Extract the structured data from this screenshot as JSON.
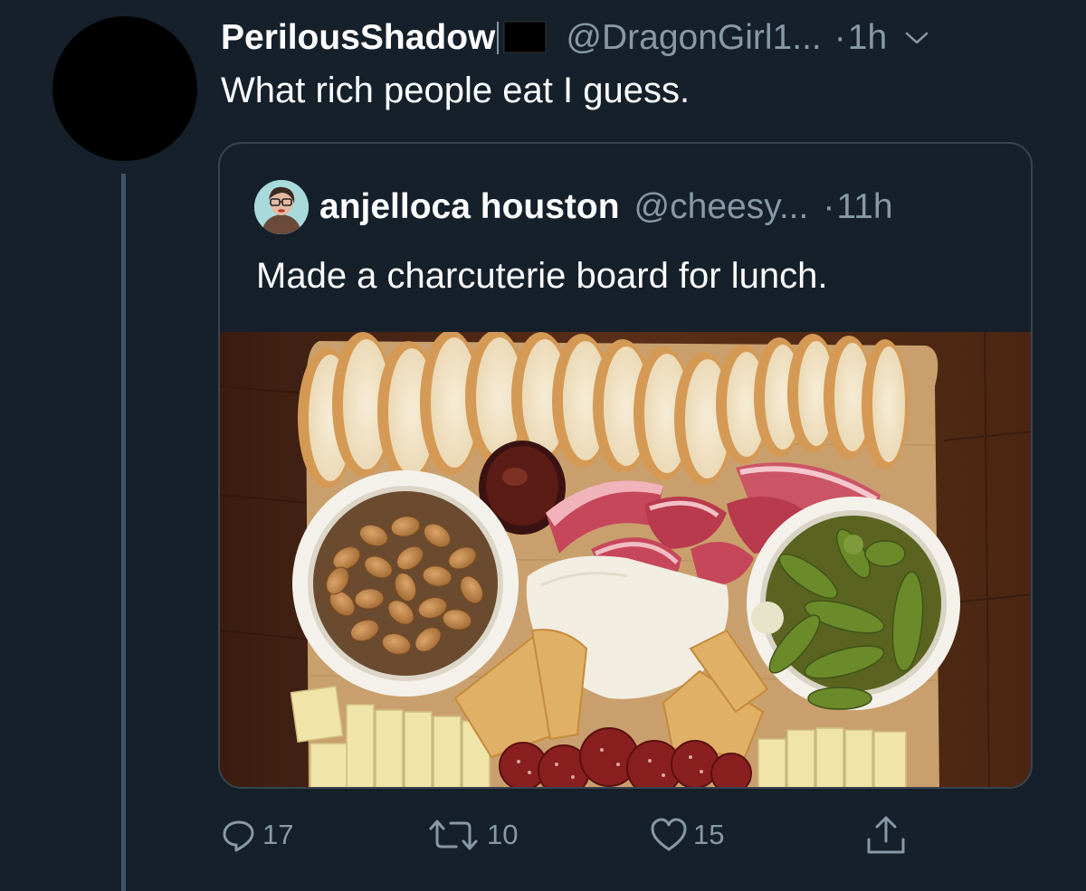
{
  "tweet": {
    "display_name": "PerilousShadow",
    "handle": "@DragonGirl1...",
    "dot": "·",
    "time": "1h",
    "text": "What rich people eat I guess."
  },
  "quoted_tweet": {
    "display_name": "anjelloca houston",
    "handle": "@cheesy...",
    "dot": "·",
    "time": "11h",
    "text": "Made a charcuterie board for lunch."
  },
  "actions": {
    "reply_count": "17",
    "retweet_count": "10",
    "like_count": "15"
  },
  "icons": {
    "flag": "black-flag-icon",
    "chevron": "chevron-down-icon",
    "reply": "reply-icon",
    "retweet": "retweet-icon",
    "like": "heart-icon",
    "share": "share-icon"
  },
  "colors": {
    "background": "#15202b",
    "text_primary": "#ffffff",
    "text_secondary": "#8899a6",
    "border": "#38444d",
    "thread_line": "#3d5466"
  }
}
